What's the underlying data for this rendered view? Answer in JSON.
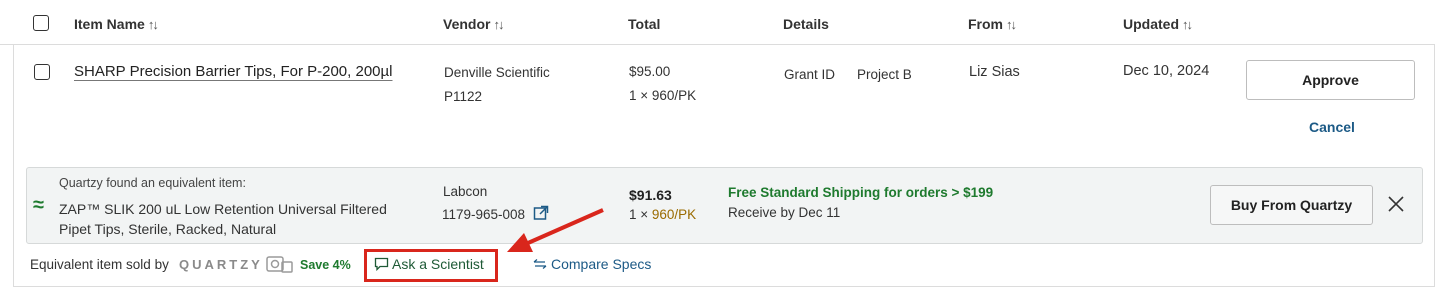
{
  "header": {
    "item_name": "Item Name",
    "vendor": "Vendor",
    "total": "Total",
    "details": "Details",
    "from": "From",
    "updated": "Updated",
    "sort_glyph": "↑↓"
  },
  "item": {
    "name": "SHARP Precision Barrier Tips, For P-200, 200µl",
    "vendor": "Denville Scientific",
    "catalog": "P1122",
    "total": "$95.00",
    "qty": "1 × 960/PK",
    "details_grant": "Grant ID",
    "details_project": "Project B",
    "from": "Liz Sias",
    "updated": "Dec 10, 2024",
    "approve_label": "Approve",
    "cancel_label": "Cancel"
  },
  "suggestion": {
    "found_text": "Quartzy found an equivalent item:",
    "name": "ZAP™ SLIK 200 uL Low Retention Universal Filtered Pipet Tips, Sterile, Racked, Natural",
    "vendor": "Labcon",
    "catalog": "1179-965-008",
    "price": "$91.63",
    "qty_prefix": "1 × ",
    "qty_unit": "960/PK",
    "shipping": "Free Standard Shipping for orders > $199",
    "receive": "Receive by Dec 11",
    "buy_label": "Buy From Quartzy",
    "approx_glyph": "≈"
  },
  "footer": {
    "equiv_text": "Equivalent item sold by",
    "brand": "QUARTZY",
    "save": "Save 4%",
    "ask_label": "Ask a Scientist",
    "compare_label": "Compare Specs"
  },
  "colors": {
    "green": "#1e7a2e",
    "link_blue": "#1c5a86",
    "highlight_red": "#d9261c"
  }
}
